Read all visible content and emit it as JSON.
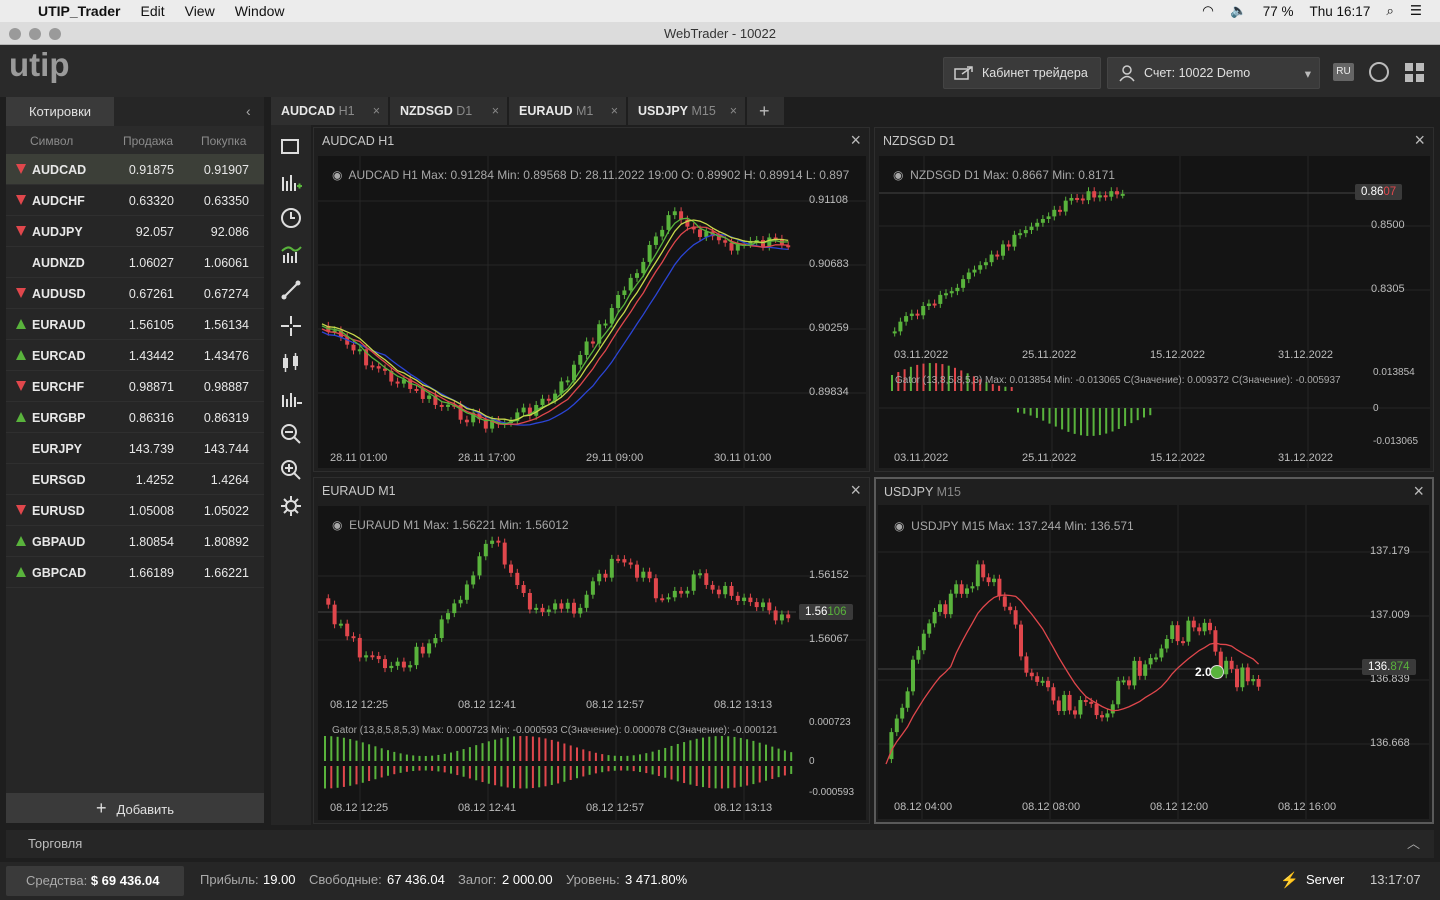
{
  "menubar": {
    "app": "UTIP_Trader",
    "items": [
      "Edit",
      "View",
      "Window"
    ],
    "battery": "77 %",
    "clock": "Thu 16:17"
  },
  "window": {
    "title": "WebTrader - 10022"
  },
  "header": {
    "logo": "utip",
    "cabinet": "Кабинет трейдера",
    "account": "Счет: 10022 Demo",
    "lang": "RU"
  },
  "quotes": {
    "tab": "Котировки",
    "col_symbol": "Символ",
    "col_bid": "Продажа",
    "col_ask": "Покупка",
    "add": "Добавить",
    "rows": [
      {
        "symbol": "AUDCAD",
        "bid": "0.91875",
        "ask": "0.91907",
        "dir": "down"
      },
      {
        "symbol": "AUDCHF",
        "bid": "0.63320",
        "ask": "0.63350",
        "dir": "down"
      },
      {
        "symbol": "AUDJPY",
        "bid": "92.057",
        "ask": "92.086",
        "dir": "down"
      },
      {
        "symbol": "AUDNZD",
        "bid": "1.06027",
        "ask": "1.06061",
        "dir": "none"
      },
      {
        "symbol": "AUDUSD",
        "bid": "0.67261",
        "ask": "0.67274",
        "dir": "down"
      },
      {
        "symbol": "EURAUD",
        "bid": "1.56105",
        "ask": "1.56134",
        "dir": "up"
      },
      {
        "symbol": "EURCAD",
        "bid": "1.43442",
        "ask": "1.43476",
        "dir": "up"
      },
      {
        "symbol": "EURCHF",
        "bid": "0.98871",
        "ask": "0.98887",
        "dir": "down"
      },
      {
        "symbol": "EURGBP",
        "bid": "0.86316",
        "ask": "0.86319",
        "dir": "up"
      },
      {
        "symbol": "EURJPY",
        "bid": "143.739",
        "ask": "143.744",
        "dir": "none"
      },
      {
        "symbol": "EURSGD",
        "bid": "1.4252",
        "ask": "1.4264",
        "dir": "none"
      },
      {
        "symbol": "EURUSD",
        "bid": "1.05008",
        "ask": "1.05022",
        "dir": "down"
      },
      {
        "symbol": "GBPAUD",
        "bid": "1.80854",
        "ask": "1.80892",
        "dir": "up"
      },
      {
        "symbol": "GBPCAD",
        "bid": "1.66189",
        "ask": "1.66221",
        "dir": "up"
      }
    ]
  },
  "tabs": [
    {
      "sym": "AUDCAD",
      "tf": "H1"
    },
    {
      "sym": "NZDSGD",
      "tf": "D1"
    },
    {
      "sym": "EURAUD",
      "tf": "M1"
    },
    {
      "sym": "USDJPY",
      "tf": "M15"
    }
  ],
  "charts": {
    "c1": {
      "title": "AUDCAD H1",
      "info": "AUDCAD   H1   Max: 0.91284   Min: 0.89568   D: 28.11.2022 19:00   O: 0.89902   H: 0.89914   L: 0.897",
      "y": [
        "0.91108",
        "0.90683",
        "0.90259",
        "0.89834"
      ],
      "x": [
        "28.11 01:00",
        "28.11 17:00",
        "29.11 09:00",
        "30.11 01:00"
      ]
    },
    "c2": {
      "title": "NZDSGD D1",
      "info": "NZDSGD   D1   Max: 0.8667   Min: 0.8171",
      "price_a": "0.86",
      "price_b": "07",
      "y": [
        "0.8500",
        "0.8305"
      ],
      "x": [
        "03.11.2022",
        "25.11.2022",
        "15.12.2022",
        "31.12.2022"
      ],
      "ind": "Gator (13,8,5,8,5,3)   Max: 0.013854   Min: -0.013065   C(Значение): 0.009372   C(Значение): -0.005937",
      "iy": [
        "0.013854",
        "0",
        "-0.013065"
      ]
    },
    "c3": {
      "title": "EURAUD M1",
      "info": "EURAUD   M1   Max: 1.56221   Min: 1.56012",
      "price_a": "1.56",
      "price_b": "106",
      "y": [
        "1.56152",
        "1.56067"
      ],
      "x": [
        "08.12 12:25",
        "08.12 12:41",
        "08.12 12:57",
        "08.12 13:13"
      ],
      "ind": "Gator (13,8,5,8,5,3)   Max: 0.000723   Min: -0.000593   C(Значение): 0.000078   C(Значение): -0.000121",
      "iy": [
        "0.000723",
        "0",
        "-0.000593"
      ]
    },
    "c4": {
      "title": "USDJPY",
      "tf": "M15",
      "info": "USDJPY   M15   Max: 137.244   Min: 136.571",
      "price_a": "136.",
      "price_b": "874",
      "lot": "2.00",
      "y": [
        "137.179",
        "137.009",
        "136.839",
        "136.668"
      ],
      "x": [
        "08.12 04:00",
        "08.12 08:00",
        "08.12 12:00",
        "08.12 16:00"
      ]
    }
  },
  "trade": {
    "label": "Торговля"
  },
  "status": {
    "funds_label": "Средства:",
    "funds": "$ 69 436.04",
    "profit_label": "Прибыль:",
    "profit": "19.00",
    "free_label": "Свободные:",
    "free": "67 436.04",
    "margin_label": "Залог:",
    "margin": "2 000.00",
    "level_label": "Уровень:",
    "level": "3 471.80%",
    "server": "Server",
    "time": "13:17:07"
  },
  "colors": {
    "up": "#59b33c",
    "down": "#e0474c",
    "bg": "#1e1e1e"
  }
}
